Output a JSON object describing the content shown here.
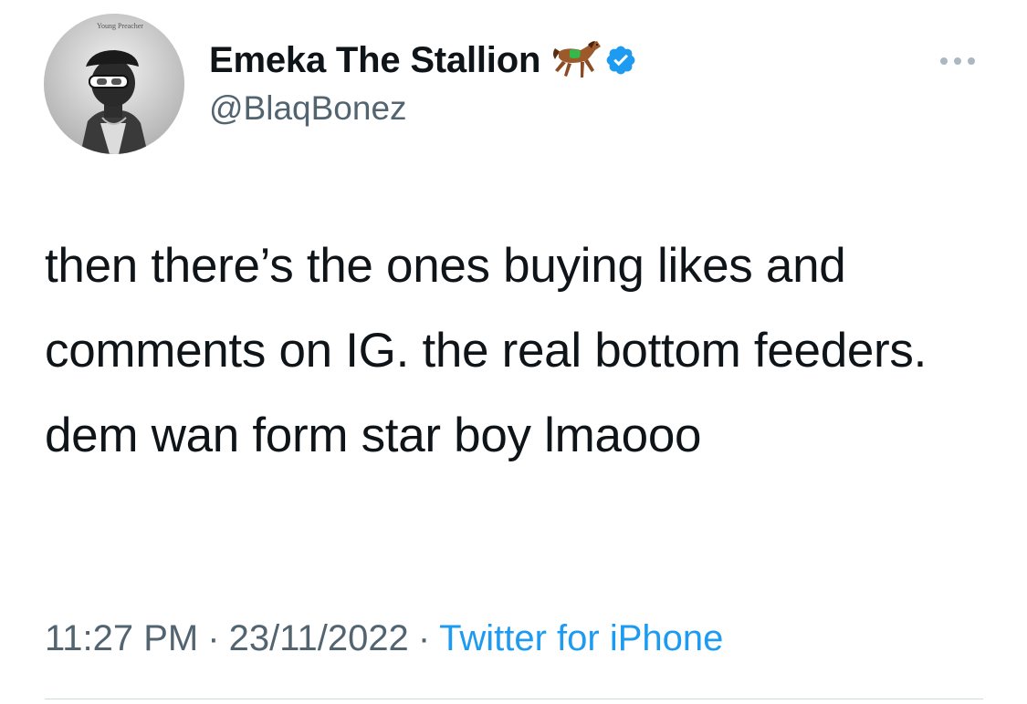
{
  "author": {
    "display_name": "Emeka The Stallion",
    "handle": "@BlaqBonez",
    "avatar_caption": "Young Preacher",
    "name_emoji_icon": "horse-icon",
    "verified_icon": "verified-badge-icon"
  },
  "menu": {
    "more_icon": "more-dots-icon"
  },
  "tweet": {
    "text": "then there’s the ones buying likes and comments on IG. the real bottom feeders. dem wan form star boy lmaooo"
  },
  "meta": {
    "time": "11:27 PM",
    "separator": "·",
    "date": "23/11/2022",
    "source": "Twitter for iPhone"
  },
  "colors": {
    "text_primary": "#0f1419",
    "text_secondary": "#536471",
    "accent": "#1d9bf0",
    "divider": "#cfd9de"
  }
}
